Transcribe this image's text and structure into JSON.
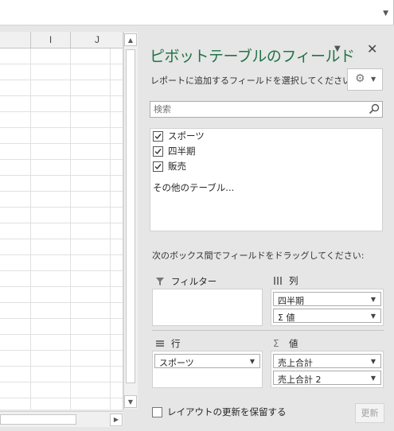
{
  "sheet": {
    "columns": [
      "I",
      "J"
    ]
  },
  "pane": {
    "title": "ピボットテーブルのフィールド",
    "description": "レポートに追加するフィールドを選択してください:",
    "search_placeholder": "検索",
    "fields": [
      {
        "label": "スポーツ",
        "checked": true
      },
      {
        "label": "四半期",
        "checked": true
      },
      {
        "label": "販売",
        "checked": true
      }
    ],
    "more_tables": "その他のテーブル...",
    "areas_description": "次のボックス間でフィールドをドラッグしてください:",
    "filters": {
      "label": "フィルター",
      "items": []
    },
    "columns": {
      "label": "列",
      "items": [
        "四半期",
        "Σ 値"
      ]
    },
    "rows": {
      "label": "行",
      "items": [
        "スポーツ"
      ]
    },
    "values": {
      "label": "値",
      "items": [
        "売上合計",
        "売上合計 2"
      ]
    },
    "defer_label": "レイアウトの更新を保留する",
    "update_label": "更新"
  },
  "colors": {
    "accent": "#217346",
    "pane_bg": "#e6e6e6"
  }
}
